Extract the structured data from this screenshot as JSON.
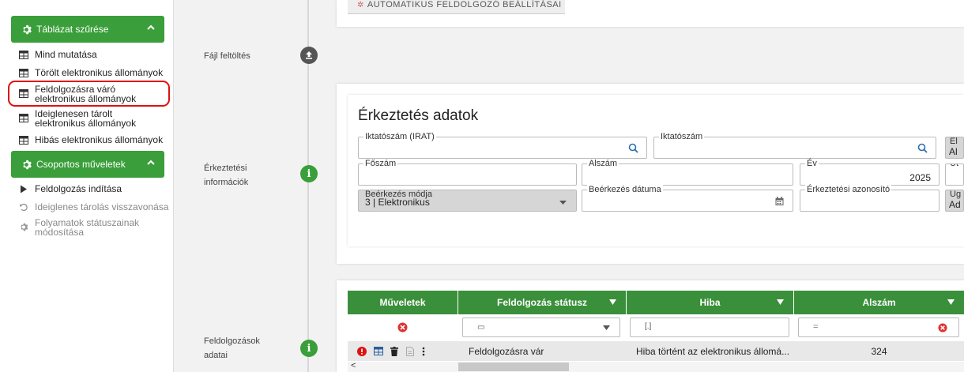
{
  "sidebar": {
    "filter_panel": {
      "title": "Táblázat szűrése"
    },
    "filter_items": [
      {
        "label": "Mind mutatása"
      },
      {
        "label": "Törölt elektronikus állományok"
      },
      {
        "label": "Feldolgozásra váró elektronikus állományok"
      },
      {
        "label": "Ideiglenesen tárolt elektronikus állományok"
      },
      {
        "label": "Hibás elektronikus állományok"
      }
    ],
    "actions_panel": {
      "title": "Csoportos műveletek"
    },
    "action_items": [
      {
        "label": "Feldolgozás indítása",
        "enabled": true
      },
      {
        "label": "Ideiglenes tárolás visszavonása",
        "enabled": false
      },
      {
        "label": "Folyamatok státuszainak módosítása",
        "enabled": false
      }
    ]
  },
  "top_card": {
    "button_label": "AUTOMATIKUS FELDOLGOZÓ BEÁLLÍTÁSAI"
  },
  "timeline": {
    "upload_label": "Fájl feltöltés",
    "arrival_label": "Érkeztetési információk",
    "processing_label": "Feldolgozások adatai"
  },
  "arrival_form": {
    "title": "Érkeztetés adatok",
    "fields": {
      "irat_label": "Iktatószám (IRAT)",
      "irat_value": "",
      "iktatoszam_label": "Iktatószám",
      "iktatoszam_value": "",
      "el_label": "El",
      "el_value": "Al",
      "foszam_label": "Főszám",
      "foszam_value": "",
      "alszam_label": "Alszám",
      "alszam_value": "",
      "ev_label": "Év",
      "ev_value": "2025",
      "ut_label": "Ut",
      "beerkezes_modja_label": "Beérkezés módja",
      "beerkezes_modja_value": "3 | Elektronikus",
      "beerkezes_datuma_label": "Beérkezés dátuma",
      "beerkezes_datuma_value": "",
      "erkeztetesi_azonosito_label": "Érkeztetési azonosító",
      "erkeztetesi_azonosito_value": "",
      "ug_label": "Üg",
      "ug_value": "Ad"
    }
  },
  "grid": {
    "columns": [
      {
        "label": "Műveletek",
        "sortable": false
      },
      {
        "label": "Feldolgozás státusz",
        "sortable": true
      },
      {
        "label": "Hiba",
        "sortable": true
      },
      {
        "label": "Alszám",
        "sortable": true
      }
    ],
    "filters": {
      "status_filter_icon": "▭",
      "hiba_filter_icon": "[.]",
      "alszam_filter_icon": "="
    },
    "rows": [
      {
        "status": "Feldolgozásra vár",
        "hiba": "Hiba történt az elektronikus állomá...",
        "alszam": "324"
      }
    ],
    "scroll_left_label": "<"
  },
  "colors": {
    "accent": "#3a9e3a",
    "header": "#3a8f3a",
    "danger": "#e03131",
    "highlight": "#dd1111"
  }
}
